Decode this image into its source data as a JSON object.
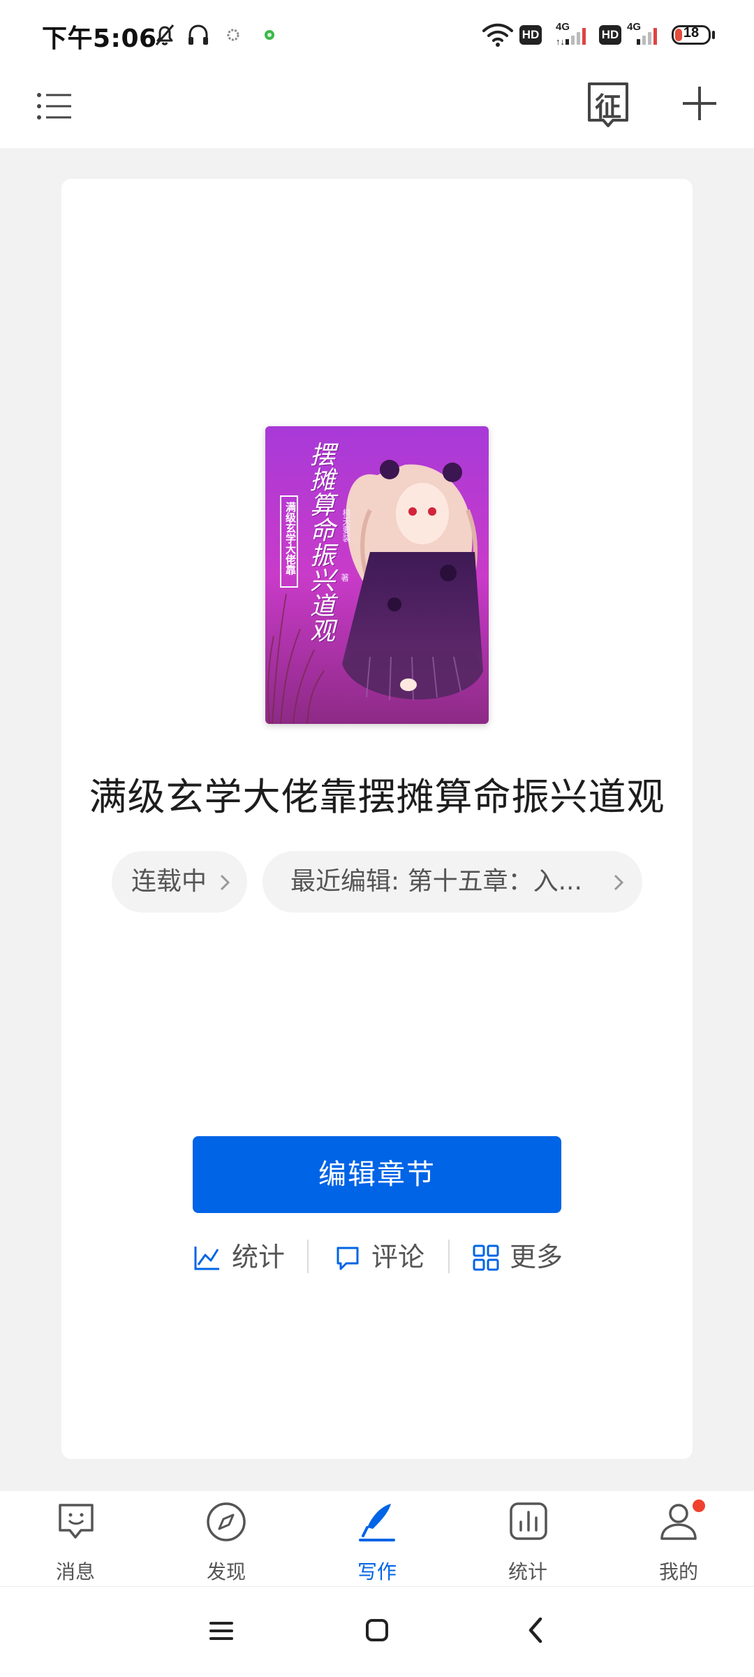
{
  "status_bar": {
    "time": "下午5:06",
    "battery": "18",
    "network_1": "4G",
    "network_2": "4G",
    "hd_1": "HD",
    "hd_2": "HD"
  },
  "header": {
    "icons": [
      "menu-list-icon",
      "contest-stamp-icon",
      "add-plus-icon"
    ],
    "contest_glyph": "征"
  },
  "book": {
    "title": "满级玄学大佬靠摆摊算命振兴道观",
    "cover": {
      "title_vertical": "摆摊算命振兴道观",
      "title_boxed": "满级玄学大佬靠",
      "author": "柯天要装",
      "author_suffix": "著"
    },
    "status_label": "连载中",
    "recent_edit_label": "最近编辑: 第十五章：入..."
  },
  "primary_action": {
    "label": "编辑章节"
  },
  "actions": [
    {
      "icon": "line-chart-icon",
      "label": "统计"
    },
    {
      "icon": "comment-icon",
      "label": "评论"
    },
    {
      "icon": "grid-more-icon",
      "label": "更多"
    }
  ],
  "tabs": [
    {
      "icon": "message-face-icon",
      "label": "消息",
      "active": false
    },
    {
      "icon": "compass-icon",
      "label": "发现",
      "active": false
    },
    {
      "icon": "pen-write-icon",
      "label": "写作",
      "active": true
    },
    {
      "icon": "bar-stats-icon",
      "label": "统计",
      "active": false
    },
    {
      "icon": "user-profile-icon",
      "label": "我的",
      "active": false,
      "badge": true
    }
  ],
  "colors": {
    "accent": "#0064e6",
    "badge": "#f0412f",
    "background": "#f2f2f2",
    "cover_purple": "#b93ad6"
  }
}
